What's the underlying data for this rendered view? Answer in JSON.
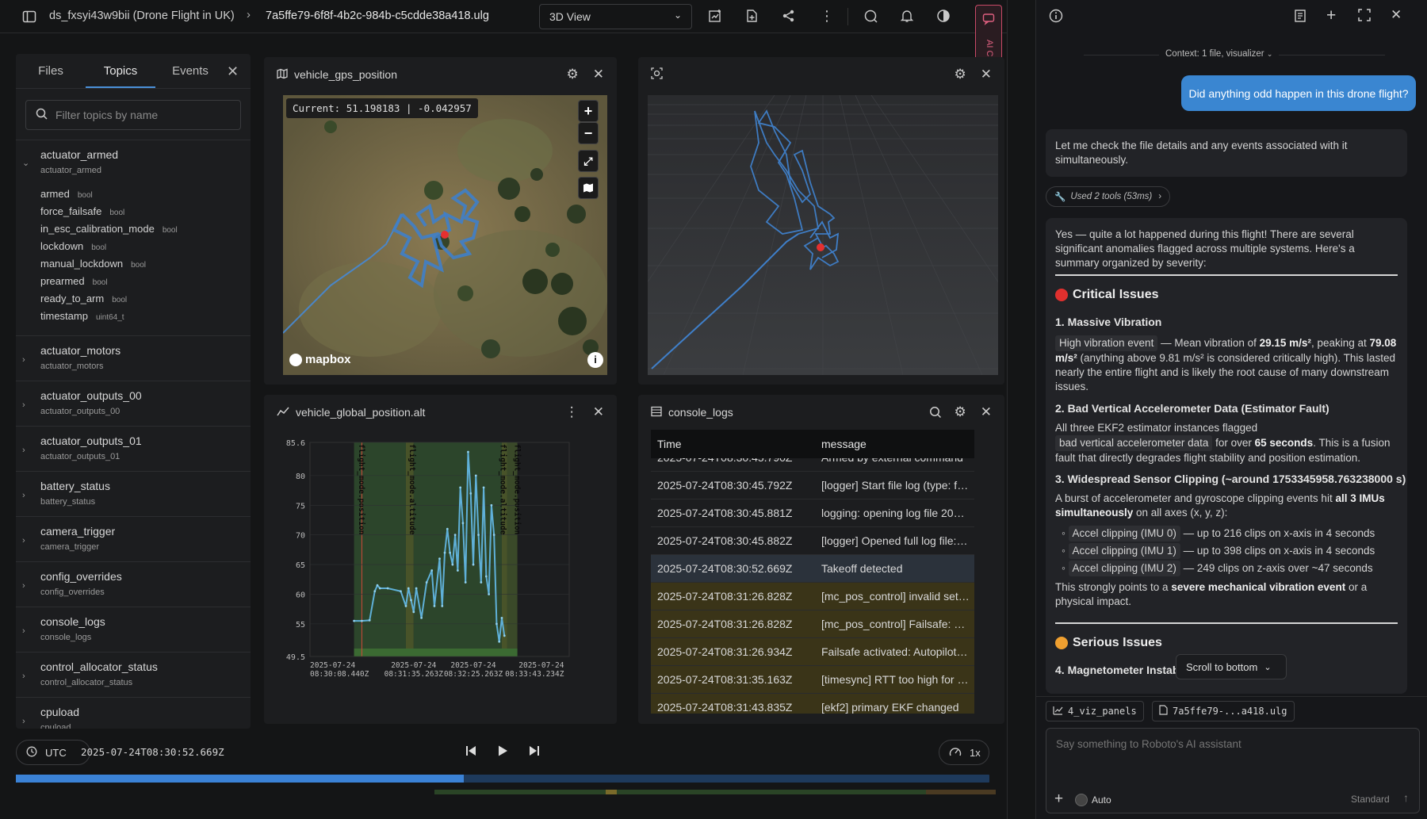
{
  "topbar": {
    "dataset": "ds_fxsyi43w9bii (Drone Flight in UK)",
    "file": "7a5ffe79-6f8f-4b2c-984b-c5cdde38a418.ulg",
    "view_select": "3D View"
  },
  "left_panel": {
    "tabs": [
      "Files",
      "Topics",
      "Events"
    ],
    "active_tab": "Topics",
    "filter_placeholder": "Filter topics by name",
    "expanded_topic": {
      "name": "actuator_armed",
      "sub": "actuator_armed",
      "fields": [
        {
          "name": "armed",
          "type": "bool"
        },
        {
          "name": "force_failsafe",
          "type": "bool"
        },
        {
          "name": "in_esc_calibration_mode",
          "type": "bool"
        },
        {
          "name": "lockdown",
          "type": "bool"
        },
        {
          "name": "manual_lockdown",
          "type": "bool"
        },
        {
          "name": "prearmed",
          "type": "bool"
        },
        {
          "name": "ready_to_arm",
          "type": "bool"
        },
        {
          "name": "timestamp",
          "type": "uint64_t"
        }
      ]
    },
    "topics": [
      {
        "name": "actuator_motors",
        "sub": "actuator_motors"
      },
      {
        "name": "actuator_outputs_00",
        "sub": "actuator_outputs_00"
      },
      {
        "name": "actuator_outputs_01",
        "sub": "actuator_outputs_01"
      },
      {
        "name": "battery_status",
        "sub": "battery_status"
      },
      {
        "name": "camera_trigger",
        "sub": "camera_trigger"
      },
      {
        "name": "config_overrides",
        "sub": "config_overrides"
      },
      {
        "name": "console_logs",
        "sub": "console_logs"
      },
      {
        "name": "control_allocator_status",
        "sub": "control_allocator_status"
      },
      {
        "name": "cpuload",
        "sub": "cpuload"
      }
    ]
  },
  "map_panel": {
    "title": "vehicle_gps_position",
    "current_label": "Current: 51.198183 | -0.042957",
    "attribution": "mapbox"
  },
  "chart_panel": {
    "title": "vehicle_global_position.alt"
  },
  "chart_data": {
    "type": "line",
    "title": "",
    "xlabel": "",
    "ylabel": "",
    "y_ticks": [
      "85.6",
      "80",
      "75",
      "70",
      "65",
      "60",
      "55",
      "49.5"
    ],
    "ylim": [
      49.5,
      85.6
    ],
    "x_ticks": [
      "2025-07-24\n08:30:08.440Z",
      "2025-07-24\n08:31:35.263Z",
      "2025-07-24\n08:32:25.263Z",
      "2025-07-24\n08:33:43.234Z"
    ],
    "mode_bands": [
      "flight_mode.position",
      "flight_mode.altitude",
      "flight_mode.altitude",
      "flight_mode.position"
    ],
    "x": [
      0.17,
      0.2,
      0.23,
      0.25,
      0.26,
      0.27,
      0.3,
      0.35,
      0.37,
      0.38,
      0.39,
      0.4,
      0.41,
      0.43,
      0.45,
      0.47,
      0.48,
      0.5,
      0.51,
      0.52,
      0.53,
      0.54,
      0.55,
      0.56,
      0.57,
      0.58,
      0.59,
      0.6,
      0.61,
      0.62,
      0.63,
      0.64,
      0.65,
      0.66,
      0.67,
      0.68,
      0.69,
      0.7,
      0.71,
      0.72,
      0.73,
      0.74,
      0.75
    ],
    "values": [
      55.5,
      55.5,
      55.6,
      60.5,
      61.5,
      61,
      61,
      60.5,
      58,
      61,
      59,
      57,
      61,
      56,
      62,
      64,
      58,
      66,
      58,
      67,
      71,
      67,
      65,
      70,
      64,
      78,
      72,
      62,
      84,
      77,
      65,
      80,
      70,
      62,
      78,
      63,
      60,
      75,
      70,
      55,
      52,
      56,
      53
    ]
  },
  "console_panel": {
    "title": "console_logs",
    "columns": [
      "Time",
      "message"
    ],
    "rows": [
      {
        "time": "2025-07-24T08:30:45.790Z",
        "msg": "Armed by external command"
      },
      {
        "time": "2025-07-24T08:30:45.792Z",
        "msg": "[logger] Start file log (type: full)"
      },
      {
        "time": "2025-07-24T08:30:45.881Z",
        "msg": "logging: opening log file 2025-7-24"
      },
      {
        "time": "2025-07-24T08:30:45.882Z",
        "msg": "[logger] Opened full log file: ./log"
      },
      {
        "time": "2025-07-24T08:30:52.669Z",
        "msg": "Takeoff detected"
      },
      {
        "time": "2025-07-24T08:31:26.828Z",
        "msg": "[mc_pos_control] invalid setpoints"
      },
      {
        "time": "2025-07-24T08:31:26.828Z",
        "msg": "[mc_pos_control] Failsafe: blind land"
      },
      {
        "time": "2025-07-24T08:31:26.934Z",
        "msg": "Failsafe activated: Autopilot disengaged"
      },
      {
        "time": "2025-07-24T08:31:35.163Z",
        "msg": "[timesync] RTT too high for timesync"
      },
      {
        "time": "2025-07-24T08:31:43.835Z",
        "msg": "[ekf2] primary EKF changed"
      }
    ]
  },
  "playback": {
    "tz": "UTC",
    "timestamp": "2025-07-24T08:30:52.669Z",
    "speed": "1x",
    "progress": 0.46
  },
  "chat": {
    "side_tab": "AI Chat",
    "context": "Context: 1 file, visualizer",
    "user_msg": "Did anything odd happen in this drone flight?",
    "reply1": "Let me check the file details and any events associated with it simultaneously.",
    "tools": "Used 2 tools (53ms)",
    "intro": "Yes — quite a lot happened during this flight! There are several significant anomalies flagged across multiple systems. Here's a summary organized by severity:",
    "critical": "Critical Issues",
    "i1_title": "1. Massive Vibration",
    "i1_chip": "High vibration event",
    "i1_a": " — Mean vibration of ",
    "i1_b": "29.15 m/s²",
    "i1_c": ", peaking at ",
    "i1_d": "79.08 m/s²",
    "i1_e": " (anything above 9.81 m/s² is considered critically high). This lasted nearly the entire flight and is likely the root cause of many downstream issues.",
    "i2_title": "2. Bad Vertical Accelerometer Data (Estimator Fault)",
    "i2_a": "All three EKF2 estimator instances flagged ",
    "i2_chip": "bad vertical accelerometer data",
    "i2_b": " for over ",
    "i2_c": "65 seconds",
    "i2_d": ". This is a fusion fault that directly degrades flight stability and position estimation.",
    "i3_title": "3. Widespread Sensor Clipping (~around 1753345958.763238000 s)",
    "i3_a": "A burst of accelerometer and gyroscope clipping events hit ",
    "i3_b": "all 3 IMUs simultaneously",
    "i3_c": " on all axes (x, y, z):",
    "bullets": [
      {
        "chip": "Accel clipping (IMU 0)",
        "text": " — up to 216 clips on x-axis in 4 seconds"
      },
      {
        "chip": "Accel clipping (IMU 1)",
        "text": " — up to 398 clips on x-axis in 4 seconds"
      },
      {
        "chip": "Accel clipping (IMU 2)",
        "text": " — 249 clips on z-axis over ~47 seconds"
      }
    ],
    "i3_d": "This strongly points to a ",
    "i3_e": "severe mechanical vibration event",
    "i3_f": " or a physical impact.",
    "serious": "Serious Issues",
    "i4_title": "4. Magnetometer Instab",
    "scroll_btn": "Scroll to bottom",
    "ctx_chips": [
      "4_viz_panels",
      "7a5ffe79-...a418.ulg"
    ],
    "input_placeholder": "Say something to Roboto's AI assistant",
    "auto": "Auto",
    "mode": "Standard"
  }
}
